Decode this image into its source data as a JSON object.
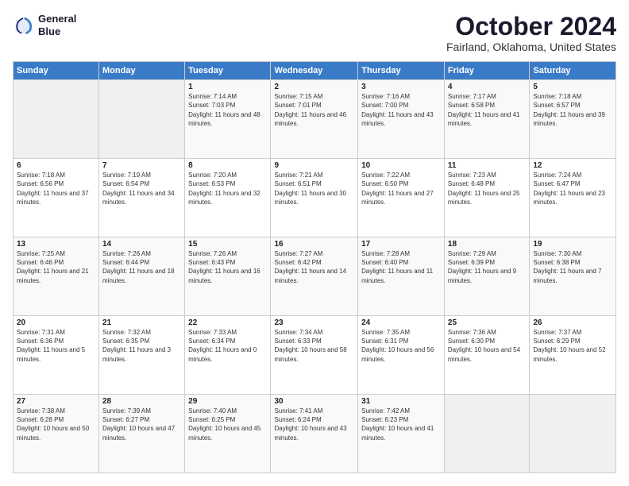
{
  "logo": {
    "line1": "General",
    "line2": "Blue"
  },
  "title": "October 2024",
  "subtitle": "Fairland, Oklahoma, United States",
  "days_of_week": [
    "Sunday",
    "Monday",
    "Tuesday",
    "Wednesday",
    "Thursday",
    "Friday",
    "Saturday"
  ],
  "weeks": [
    [
      {
        "day": "",
        "info": ""
      },
      {
        "day": "",
        "info": ""
      },
      {
        "day": "1",
        "info": "Sunrise: 7:14 AM\nSunset: 7:03 PM\nDaylight: 11 hours and 48 minutes."
      },
      {
        "day": "2",
        "info": "Sunrise: 7:15 AM\nSunset: 7:01 PM\nDaylight: 11 hours and 46 minutes."
      },
      {
        "day": "3",
        "info": "Sunrise: 7:16 AM\nSunset: 7:00 PM\nDaylight: 11 hours and 43 minutes."
      },
      {
        "day": "4",
        "info": "Sunrise: 7:17 AM\nSunset: 6:58 PM\nDaylight: 11 hours and 41 minutes."
      },
      {
        "day": "5",
        "info": "Sunrise: 7:18 AM\nSunset: 6:57 PM\nDaylight: 11 hours and 39 minutes."
      }
    ],
    [
      {
        "day": "6",
        "info": "Sunrise: 7:18 AM\nSunset: 6:56 PM\nDaylight: 11 hours and 37 minutes."
      },
      {
        "day": "7",
        "info": "Sunrise: 7:19 AM\nSunset: 6:54 PM\nDaylight: 11 hours and 34 minutes."
      },
      {
        "day": "8",
        "info": "Sunrise: 7:20 AM\nSunset: 6:53 PM\nDaylight: 11 hours and 32 minutes."
      },
      {
        "day": "9",
        "info": "Sunrise: 7:21 AM\nSunset: 6:51 PM\nDaylight: 11 hours and 30 minutes."
      },
      {
        "day": "10",
        "info": "Sunrise: 7:22 AM\nSunset: 6:50 PM\nDaylight: 11 hours and 27 minutes."
      },
      {
        "day": "11",
        "info": "Sunrise: 7:23 AM\nSunset: 6:48 PM\nDaylight: 11 hours and 25 minutes."
      },
      {
        "day": "12",
        "info": "Sunrise: 7:24 AM\nSunset: 6:47 PM\nDaylight: 11 hours and 23 minutes."
      }
    ],
    [
      {
        "day": "13",
        "info": "Sunrise: 7:25 AM\nSunset: 6:46 PM\nDaylight: 11 hours and 21 minutes."
      },
      {
        "day": "14",
        "info": "Sunrise: 7:26 AM\nSunset: 6:44 PM\nDaylight: 11 hours and 18 minutes."
      },
      {
        "day": "15",
        "info": "Sunrise: 7:26 AM\nSunset: 6:43 PM\nDaylight: 11 hours and 16 minutes."
      },
      {
        "day": "16",
        "info": "Sunrise: 7:27 AM\nSunset: 6:42 PM\nDaylight: 11 hours and 14 minutes."
      },
      {
        "day": "17",
        "info": "Sunrise: 7:28 AM\nSunset: 6:40 PM\nDaylight: 11 hours and 11 minutes."
      },
      {
        "day": "18",
        "info": "Sunrise: 7:29 AM\nSunset: 6:39 PM\nDaylight: 11 hours and 9 minutes."
      },
      {
        "day": "19",
        "info": "Sunrise: 7:30 AM\nSunset: 6:38 PM\nDaylight: 11 hours and 7 minutes."
      }
    ],
    [
      {
        "day": "20",
        "info": "Sunrise: 7:31 AM\nSunset: 6:36 PM\nDaylight: 11 hours and 5 minutes."
      },
      {
        "day": "21",
        "info": "Sunrise: 7:32 AM\nSunset: 6:35 PM\nDaylight: 11 hours and 3 minutes."
      },
      {
        "day": "22",
        "info": "Sunrise: 7:33 AM\nSunset: 6:34 PM\nDaylight: 11 hours and 0 minutes."
      },
      {
        "day": "23",
        "info": "Sunrise: 7:34 AM\nSunset: 6:33 PM\nDaylight: 10 hours and 58 minutes."
      },
      {
        "day": "24",
        "info": "Sunrise: 7:35 AM\nSunset: 6:31 PM\nDaylight: 10 hours and 56 minutes."
      },
      {
        "day": "25",
        "info": "Sunrise: 7:36 AM\nSunset: 6:30 PM\nDaylight: 10 hours and 54 minutes."
      },
      {
        "day": "26",
        "info": "Sunrise: 7:37 AM\nSunset: 6:29 PM\nDaylight: 10 hours and 52 minutes."
      }
    ],
    [
      {
        "day": "27",
        "info": "Sunrise: 7:38 AM\nSunset: 6:28 PM\nDaylight: 10 hours and 50 minutes."
      },
      {
        "day": "28",
        "info": "Sunrise: 7:39 AM\nSunset: 6:27 PM\nDaylight: 10 hours and 47 minutes."
      },
      {
        "day": "29",
        "info": "Sunrise: 7:40 AM\nSunset: 6:25 PM\nDaylight: 10 hours and 45 minutes."
      },
      {
        "day": "30",
        "info": "Sunrise: 7:41 AM\nSunset: 6:24 PM\nDaylight: 10 hours and 43 minutes."
      },
      {
        "day": "31",
        "info": "Sunrise: 7:42 AM\nSunset: 6:23 PM\nDaylight: 10 hours and 41 minutes."
      },
      {
        "day": "",
        "info": ""
      },
      {
        "day": "",
        "info": ""
      }
    ]
  ]
}
